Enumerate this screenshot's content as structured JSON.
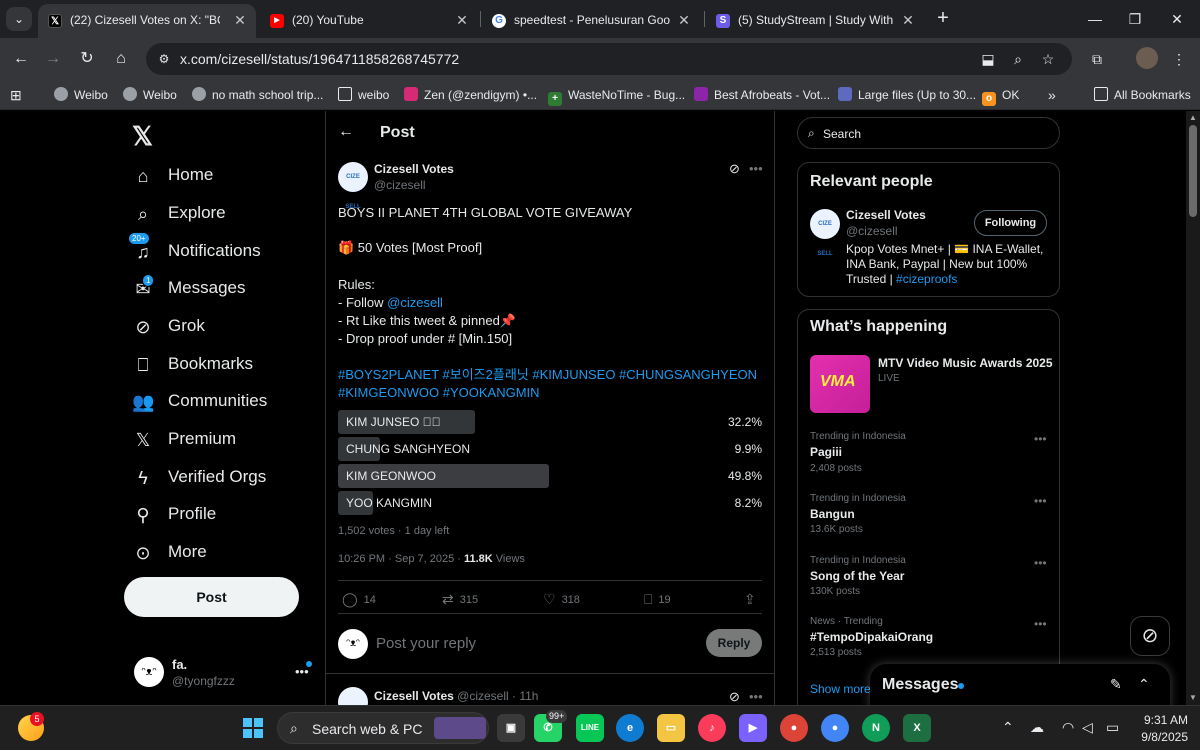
{
  "browser": {
    "tabs": [
      {
        "title": "(22) Cizesell Votes on X: \"BOYS",
        "icon": "x-favicon",
        "active": true
      },
      {
        "title": "(20) YouTube",
        "icon": "youtube-favicon",
        "active": false
      },
      {
        "title": "speedtest - Penelusuran Googl",
        "icon": "google-favicon",
        "active": false
      },
      {
        "title": "(5) StudyStream | Study With St",
        "icon": "studystream-favicon",
        "active": false
      }
    ],
    "url": "x.com/cizesell/status/1964711858268745772",
    "bookmarks": [
      {
        "label": "Weibo"
      },
      {
        "label": "Weibo"
      },
      {
        "label": "no math school trip..."
      },
      {
        "label": "weibo"
      },
      {
        "label": "Zen (@zendigym) •..."
      },
      {
        "label": "WasteNoTime - Bug..."
      },
      {
        "label": "Best Afrobeats - Vot..."
      },
      {
        "label": "Large files (Up to 30..."
      },
      {
        "label": "OK"
      }
    ],
    "all_bookmarks": "All Bookmarks"
  },
  "nav": {
    "items": [
      {
        "label": "Home",
        "icon": "home-icon"
      },
      {
        "label": "Explore",
        "icon": "search-icon"
      },
      {
        "label": "Notifications",
        "icon": "bell-icon",
        "badge": "20+"
      },
      {
        "label": "Messages",
        "icon": "mail-icon",
        "badge": "1"
      },
      {
        "label": "Grok",
        "icon": "grok-icon"
      },
      {
        "label": "Bookmarks",
        "icon": "bookmark-icon"
      },
      {
        "label": "Communities",
        "icon": "communities-icon"
      },
      {
        "label": "Premium",
        "icon": "x-premium-icon"
      },
      {
        "label": "Verified Orgs",
        "icon": "lightning-icon"
      },
      {
        "label": "Profile",
        "icon": "person-icon"
      },
      {
        "label": "More",
        "icon": "more-circle-icon"
      }
    ],
    "post_button": "Post",
    "me": {
      "name": "fa.",
      "handle": "@tyongfzzz"
    }
  },
  "post": {
    "header": "Post",
    "author_name": "Cizesell Votes",
    "author_handle": "@cizesell",
    "title": "BOYS II PLANET 4TH GLOBAL VOTE GIVEAWAY",
    "prize": "🎁 50 Votes [Most Proof]",
    "rules_heading": "Rules:",
    "rule1_prefix": "- Follow ",
    "rule1_mention": "@cizesell",
    "rule2": "- Rt Like this tweet & pinned📌",
    "rule3": "- Drop proof under # [Min.150]",
    "hashtags_line1": "#BOYS2PLANET #보이즈2플래닛 #KIMJUNSEO #CHUNGSANGHYEON",
    "hashtags_line2": "#KIMGEONWOO #YOOKANGMIN",
    "poll": [
      {
        "label": "KIM JUNSEO",
        "pct_text": "32.2%",
        "pct": 32.2,
        "checked": true
      },
      {
        "label": "CHUNG SANGHYEON",
        "pct_text": "9.9%",
        "pct": 9.9,
        "checked": false
      },
      {
        "label": "KIM GEONWOO",
        "pct_text": "49.8%",
        "pct": 49.8,
        "checked": false
      },
      {
        "label": "YOO KANGMIN",
        "pct_text": "8.2%",
        "pct": 8.2,
        "checked": false
      }
    ],
    "poll_meta": "1,502 votes · 1 day left",
    "timestamp": "10:26 PM · Sep 7, 2025 · ",
    "views_count": "11.8K",
    "views_label": " Views",
    "actions": {
      "replies": "14",
      "reposts": "315",
      "likes": "318",
      "bookmarks": "19"
    },
    "reply_placeholder": "Post your reply",
    "reply_button": "Reply",
    "next_author": "Cizesell Votes",
    "next_meta": " @cizesell · 11h"
  },
  "sidebar": {
    "search_placeholder": "Search",
    "relevant_title": "Relevant people",
    "relevant": {
      "name": "Cizesell Votes",
      "handle": "@cizesell",
      "follow_label": "Following",
      "bio": "Kpop Votes Mnet+ | 💳 INA E-Wallet, INA Bank, Paypal | New but 100% Trusted | ",
      "bio_link": "#cizeproofs"
    },
    "happening_title": "What’s happening",
    "event": {
      "title": "MTV Video Music Awards 2025",
      "status": "LIVE",
      "image_text": "VMA"
    },
    "trends": [
      {
        "meta": "Trending in Indonesia",
        "name": "Pagiii",
        "count": "2,408 posts"
      },
      {
        "meta": "Trending in Indonesia",
        "name": "Bangun",
        "count": "13.6K posts"
      },
      {
        "meta": "Trending in Indonesia",
        "name": "Song of the Year",
        "count": "130K posts"
      },
      {
        "meta": "News · Trending",
        "name": "#TempoDipakaiOrang",
        "count": "2,513 posts"
      }
    ],
    "show_more": "Show more"
  },
  "messages_drawer": {
    "title": "Messages"
  },
  "taskbar": {
    "weather_badge": "5",
    "search_placeholder": "Search web & PC",
    "whatsapp_badge": "99+",
    "time": "9:31 AM",
    "date": "9/8/2025"
  },
  "colors": {
    "accent": "#1d9bf0",
    "background": "#000000",
    "border": "#2f3336",
    "muted": "#71767b"
  }
}
